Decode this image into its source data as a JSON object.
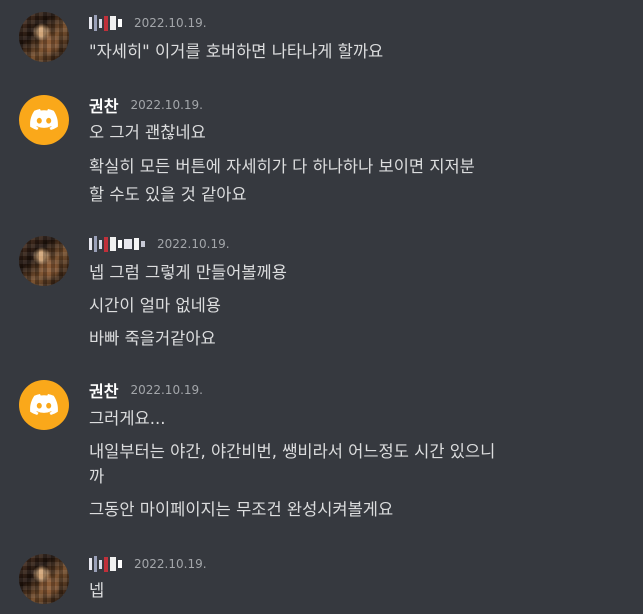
{
  "messages": [
    {
      "user": "",
      "timestamp": "2022.10.19.",
      "lines": [
        "\"자세히\" 이거를 호버하면 나타나게 할까요"
      ]
    },
    {
      "user": "권찬",
      "timestamp": "2022.10.19.",
      "lines": [
        "오 그거 괜찮네요",
        "확실히 모든 버튼에 자세히가 다 하나하나 보이면 지저분",
        "할 수도 있을 것 같아요"
      ]
    },
    {
      "user": "",
      "timestamp": "2022.10.19.",
      "lines": [
        "넵 그럼 그렇게 만들어볼께용",
        "시간이 얼마 없네용",
        "바빠 죽을거같아요"
      ]
    },
    {
      "user": "권찬",
      "timestamp": "2022.10.19.",
      "lines": [
        "그러게요...",
        "내일부터는 야간, 야간비번, 쌩비라서 어느정도 시간 있으니",
        "까",
        "그동안 마이페이지는 무조건 완성시켜볼게요"
      ]
    },
    {
      "user": "",
      "timestamp": "2022.10.19.",
      "lines": [
        "넵"
      ]
    }
  ],
  "colors": {
    "background": "#36393f",
    "discord_avatar": "#faa81a",
    "username": "#ffffff",
    "timestamp": "#a3a6aa",
    "text": "#dcddde"
  },
  "icons": {
    "discord_avatar": "discord-logo-icon"
  }
}
